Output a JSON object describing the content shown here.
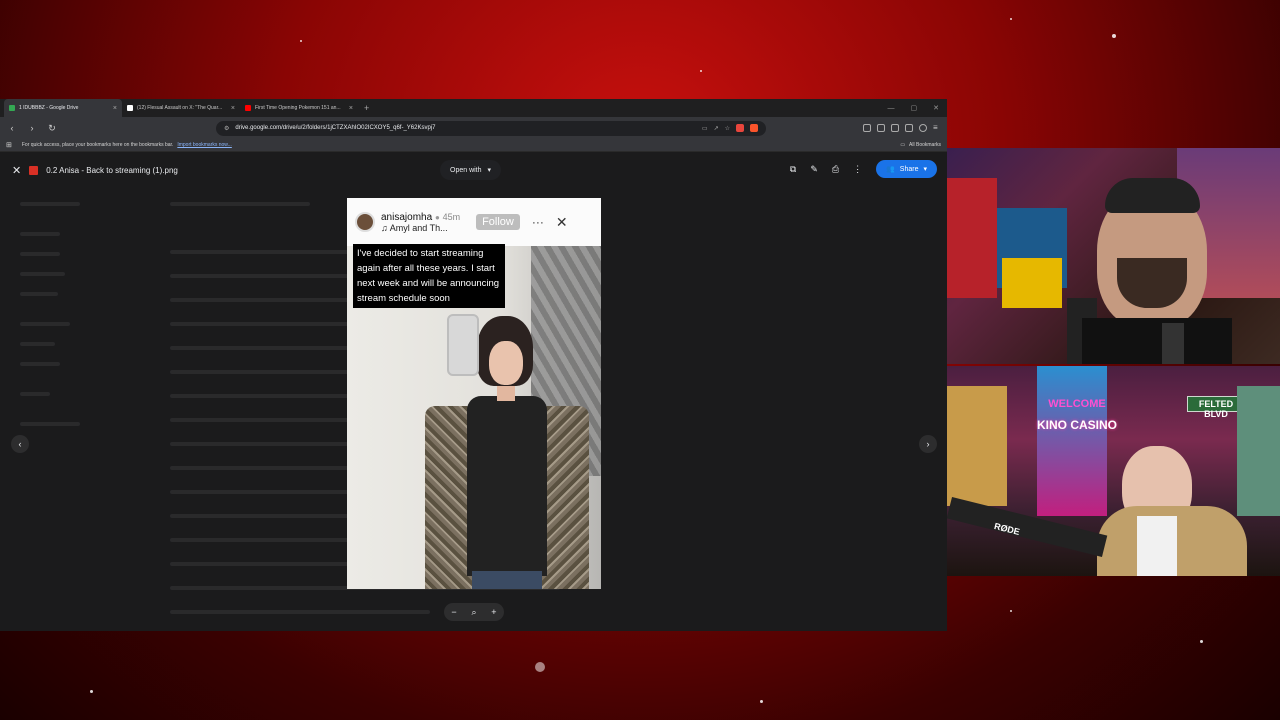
{
  "browser": {
    "tabs": [
      {
        "title": "1 IDUBBBZ - Google Drive",
        "favicon_color": "#34a853",
        "active": true
      },
      {
        "title": "(12) Flesual Assault on X: \"The Quar...",
        "favicon_color": "#ffffff",
        "active": false
      },
      {
        "title": "First Time Opening Pokemon 151 an...",
        "favicon_color": "#ff0000",
        "active": false
      }
    ],
    "url": "drive.google.com/drive/u/2/folders/1jCTZXAhIO02ICXOY5_q6f-_Y62Ksvpj7",
    "bookmarks_prompt": "For quick access, place your bookmarks here on the bookmarks bar.",
    "bookmarks_link": "Import bookmarks now...",
    "all_bookmarks": "All Bookmarks"
  },
  "viewer": {
    "filename": "0.2 Anisa - Back to streaming (1).png",
    "open_with": "Open with",
    "share": "Share",
    "accent": "#1a73e8"
  },
  "story": {
    "username": "anisajomha",
    "time": "45m",
    "subtitle": "Amyl and Th...",
    "follow": "Follow",
    "caption": "I've decided to start streaming again after all these years. I start next week and will be announcing stream schedule soon"
  },
  "cam_bottom": {
    "sign_welcome": "WELCOME",
    "sign_casino": "KINO CASINO",
    "street_sign": "FELTED BLVD",
    "mic_brand": "RØDE"
  }
}
